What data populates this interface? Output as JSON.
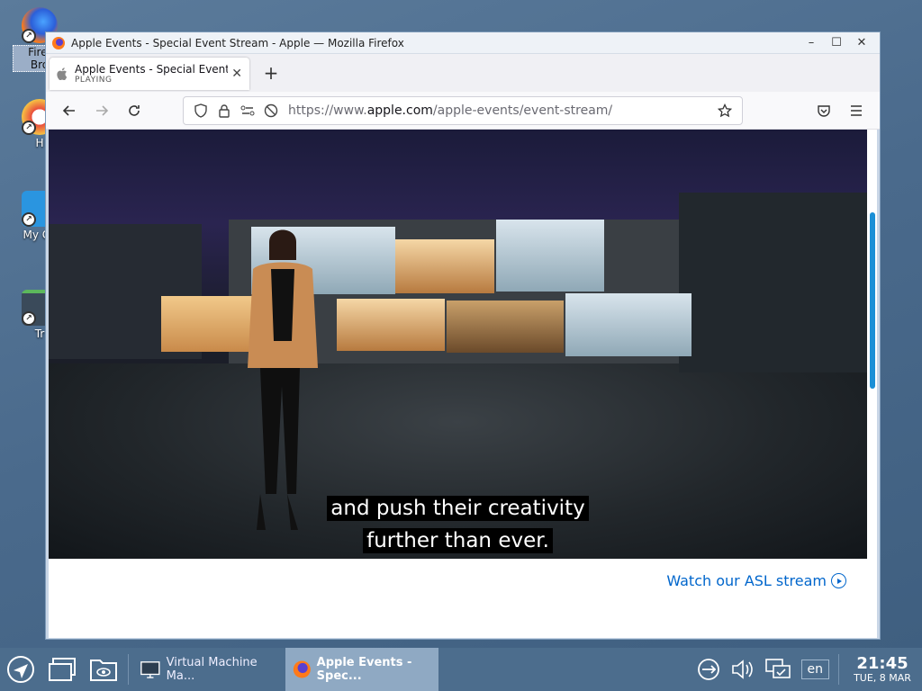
{
  "desktop": {
    "icons": [
      {
        "label": "Firef\nBro",
        "name": "firefox"
      },
      {
        "label": "H",
        "name": "help"
      },
      {
        "label": "My Co",
        "name": "my-computer"
      },
      {
        "label": "Tr",
        "name": "trash"
      }
    ]
  },
  "window": {
    "title": "Apple Events - Special Event Stream - Apple — Mozilla Firefox",
    "minimize": "–",
    "maximize": "☐",
    "close": "✕"
  },
  "tab": {
    "title": "Apple Events - Special Event",
    "status": "PLAYING",
    "close": "✕",
    "new_tab": "+"
  },
  "url": {
    "prefix": "https://www.",
    "domain": "apple.com",
    "path": "/apple-events/event-stream/"
  },
  "video": {
    "caption_line1": "and push their creativity",
    "caption_line2": "further than ever."
  },
  "page": {
    "asl_link": "Watch our ASL stream"
  },
  "taskbar": {
    "tasks": [
      {
        "label": "Virtual Machine Ma..."
      },
      {
        "label": "Apple Events - Spec..."
      }
    ],
    "lang": "en",
    "time": "21:45",
    "date": "TUE, 8 MAR"
  },
  "colors": {
    "accent": "#0066cc",
    "taskbar": "#4c6d8d",
    "scrollbar": "#1a8fd6"
  }
}
